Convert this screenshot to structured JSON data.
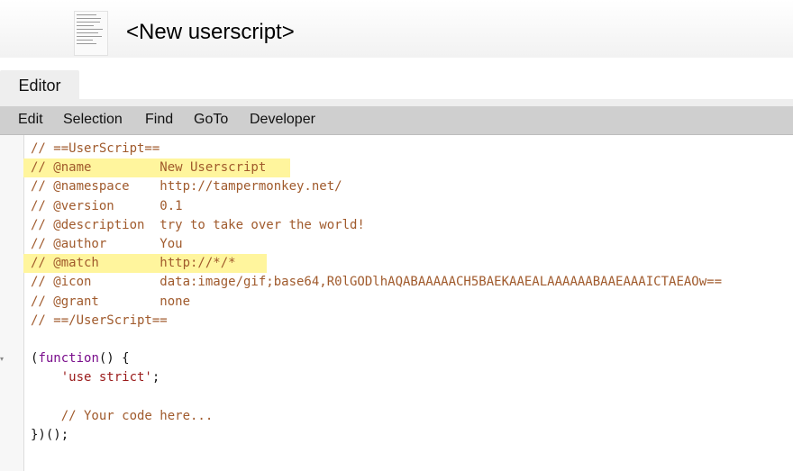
{
  "header": {
    "title": "<New userscript>",
    "icon_name": "userscript-file-icon"
  },
  "tabs": [
    {
      "label": "Editor",
      "active": true
    }
  ],
  "menu": {
    "items": [
      "Edit",
      "Selection",
      "Find",
      "GoTo",
      "Developer"
    ]
  },
  "editor": {
    "highlight_color": "#fff59d",
    "lines": [
      "// ==UserScript==",
      "// @name         New Userscript",
      "// @namespace    http://tampermonkey.net/",
      "// @version      0.1",
      "// @description  try to take over the world!",
      "// @author       You",
      "// @match        http://*/*",
      "// @icon         data:image/gif;base64,R0lGODlhAQABAAAAACH5BAEKAAEALAAAAAABAAEAAAICTAEAOw==",
      "// @grant        none",
      "// ==/UserScript==",
      "",
      "(function() {",
      "    'use strict';",
      "",
      "    // Your code here...",
      "})();"
    ],
    "code_parts": {
      "fn_kw": "function",
      "fn_open_rest": "() {",
      "open_paren": "(",
      "strict_str": "'use strict'",
      "strict_semi": ";",
      "indent": "    "
    }
  }
}
